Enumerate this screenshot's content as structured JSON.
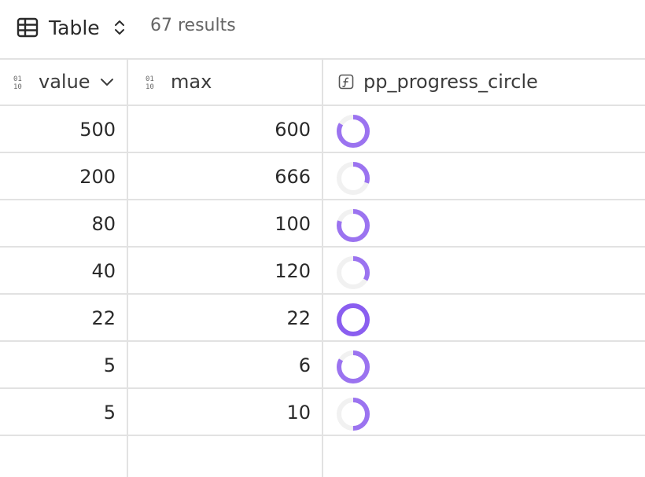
{
  "toolbar": {
    "view_label": "Table",
    "view_icon": "table-grid-icon",
    "switch_icon": "chevron-up-down-icon",
    "results_text": "67 results"
  },
  "columns": [
    {
      "label": "value",
      "icon": "number-column-icon",
      "sort_icon": "chevron-down-icon"
    },
    {
      "label": "max",
      "icon": "number-column-icon"
    },
    {
      "label": "pp_progress_circle",
      "icon": "formula-column-icon"
    }
  ],
  "rows": [
    {
      "value": "500",
      "max": "600",
      "progress": 0.8333
    },
    {
      "value": "200",
      "max": "666",
      "progress": 0.3003
    },
    {
      "value": "80",
      "max": "100",
      "progress": 0.8
    },
    {
      "value": "40",
      "max": "120",
      "progress": 0.3333
    },
    {
      "value": "22",
      "max": "22",
      "progress": 1.0
    },
    {
      "value": "5",
      "max": "6",
      "progress": 0.8333
    },
    {
      "value": "5",
      "max": "10",
      "progress": 0.5
    }
  ],
  "colors": {
    "progress_fill": "#9b73f0",
    "progress_complete": "#8a5ef0",
    "progress_track": "#f1f1f1",
    "grid_line": "#e2e2e2"
  }
}
